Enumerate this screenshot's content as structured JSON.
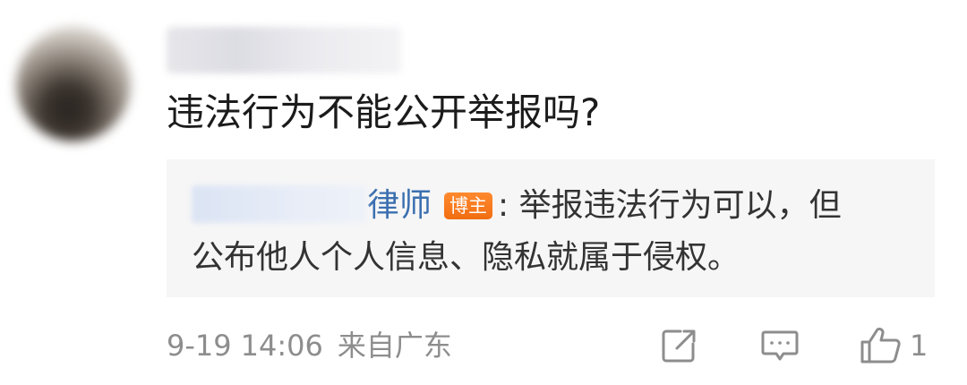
{
  "comment": {
    "text": "违法行为不能公开举报吗?"
  },
  "reply": {
    "author_suffix": "律师",
    "badge": "博主",
    "line1": ": 举报违法行为可以，但",
    "line2": "公布他人个人信息、隐私就属于侵权。"
  },
  "meta": {
    "date": "9-19",
    "time": "14:06",
    "source": "来自广东"
  },
  "actions": {
    "like_count": "1"
  },
  "colors": {
    "author_link": "#3b6fb0",
    "badge_bg": "#f26d12",
    "reply_bg": "#f6f6f6",
    "meta_gray": "#8d8d8d"
  },
  "icons": {
    "share": "share-icon",
    "comment": "comment-icon",
    "like": "thumbs-up-icon"
  }
}
